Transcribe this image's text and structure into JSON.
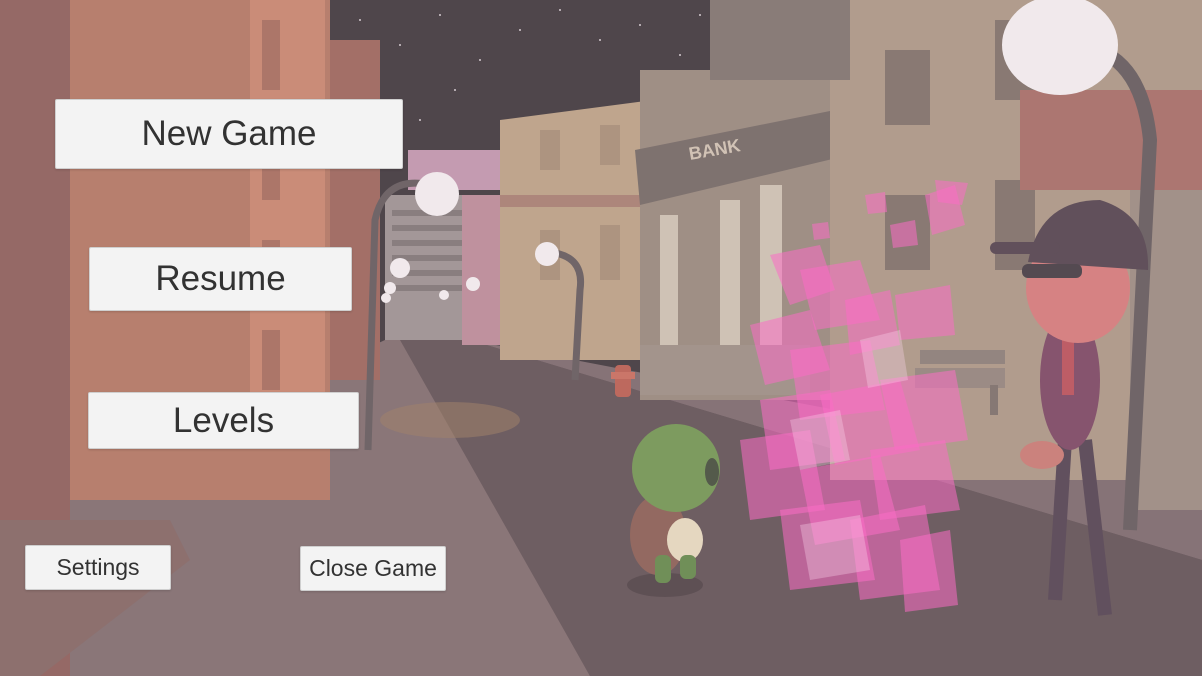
{
  "menu": {
    "new_game": "New Game",
    "resume": "Resume",
    "levels": "Levels",
    "settings": "Settings",
    "close_game": "Close Game"
  },
  "scene": {
    "bank_sign": "BANK",
    "colors": {
      "sky": "#231d22",
      "building_left": "#b06f55",
      "building_right": "#b8a48b",
      "street": "#4a3a3f",
      "sidewalk": "#7a6668",
      "pink_particles": "#ff4fc0",
      "turtle": "#5e8a3c",
      "overlay": "rgba(235,220,225,0.22)"
    },
    "icons": [
      "street-lamp-icon",
      "fire-hydrant-icon",
      "bench-icon",
      "turtle-player-icon",
      "npc-cap-man-icon",
      "pink-particle-effect"
    ]
  }
}
